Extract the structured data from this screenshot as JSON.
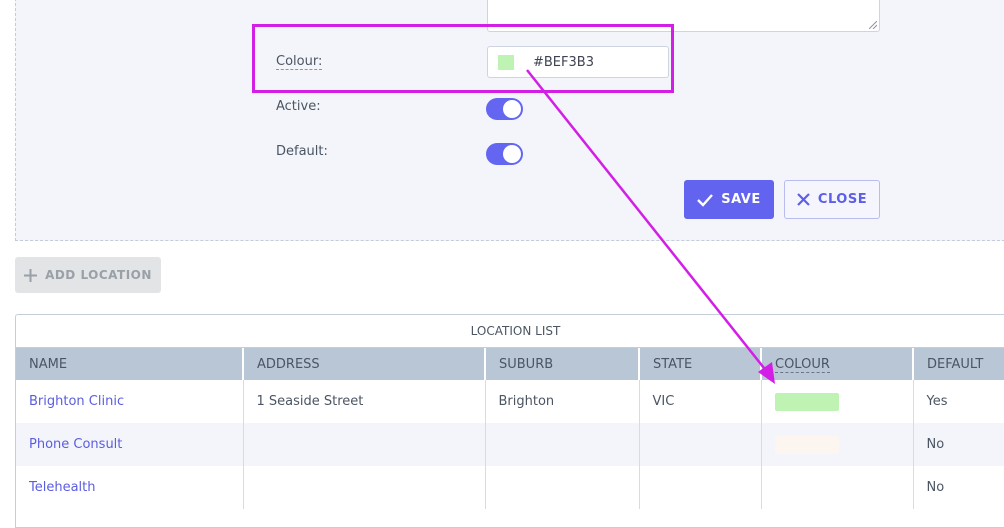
{
  "form": {
    "colour_label": "Colour:",
    "colour_value": "#BEF3B3",
    "active_label": "Active:",
    "active_on": true,
    "default_label": "Default:",
    "default_on": true,
    "save_label": "SAVE",
    "close_label": "CLOSE"
  },
  "add_location_label": "ADD LOCATION",
  "table": {
    "caption": "LOCATION LIST",
    "columns": [
      "NAME",
      "ADDRESS",
      "SUBURB",
      "STATE",
      "COLOUR",
      "DEFAULT"
    ],
    "rows": [
      {
        "name": "Brighton Clinic",
        "address": "1 Seaside Street",
        "suburb": "Brighton",
        "state": "VIC",
        "colour": "#BEF3B3",
        "default": "Yes"
      },
      {
        "name": "Phone Consult",
        "address": "",
        "suburb": "",
        "state": "",
        "colour": "#FDF6F0",
        "default": "No"
      },
      {
        "name": "Telehealth",
        "address": "",
        "suburb": "",
        "state": "",
        "colour": "",
        "default": "No"
      }
    ]
  },
  "colors": {
    "accent": "#6264EF",
    "annotation": "#D31EE6",
    "selected_colour": "#BEF3B3"
  },
  "icons": {
    "save": "check-icon",
    "close": "x-icon",
    "add": "plus-icon"
  }
}
